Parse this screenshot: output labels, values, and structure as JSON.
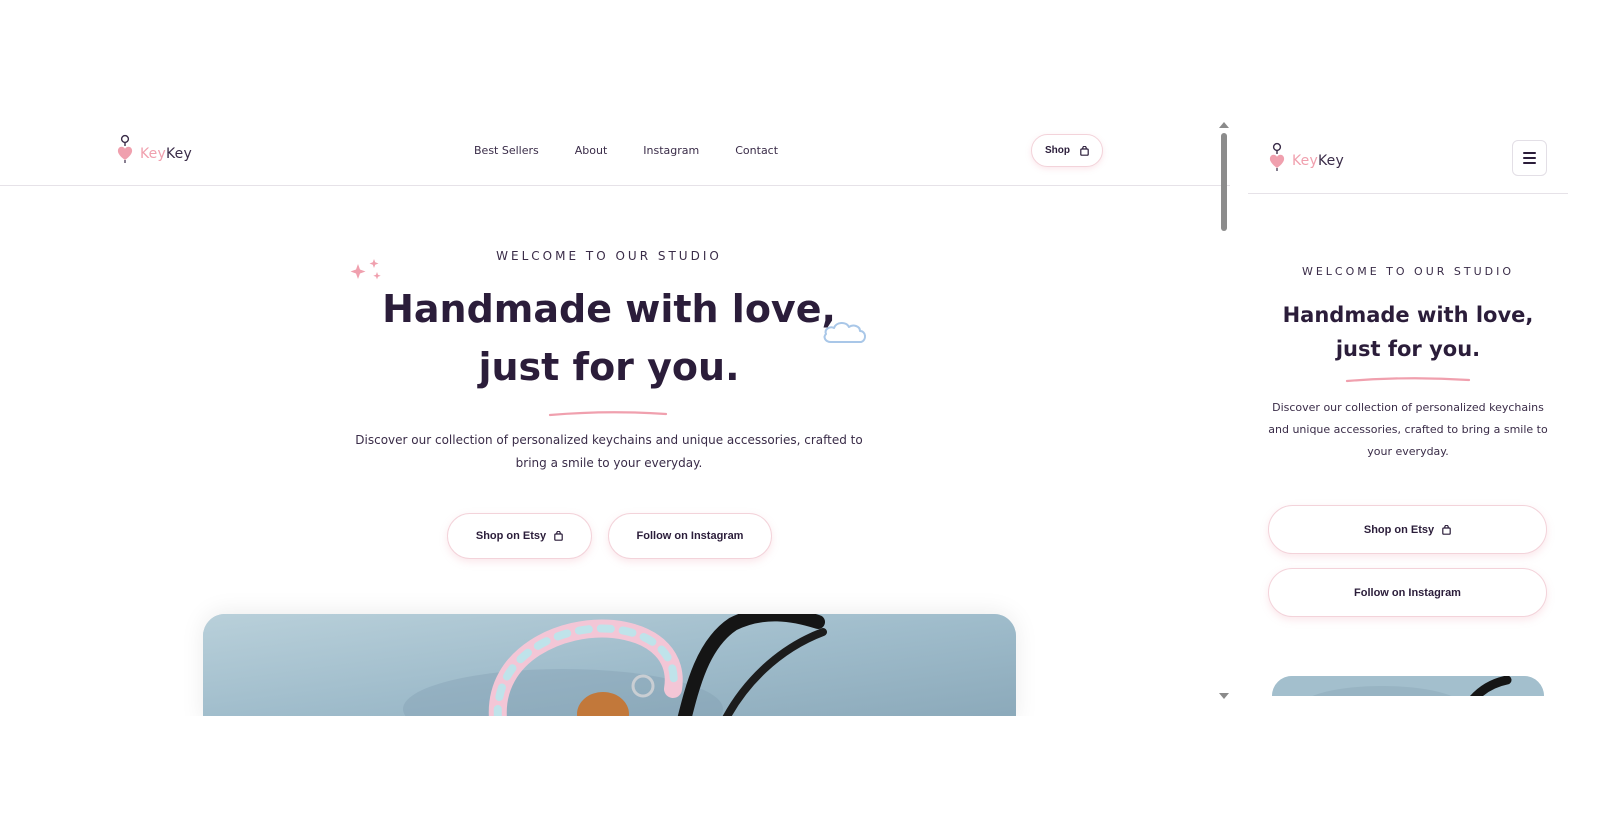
{
  "brand": {
    "part1": "Key",
    "part2": "Key"
  },
  "nav": {
    "links": [
      "Best Sellers",
      "About",
      "Instagram",
      "Contact"
    ],
    "shop_label": "Shop"
  },
  "hero": {
    "eyebrow": "WELCOME TO OUR STUDIO",
    "headline_line1": "Handmade with love,",
    "headline_line2": "just for you.",
    "description": "Discover our collection of personalized keychains and unique accessories, crafted to bring a smile to your everyday.",
    "cta_primary": "Shop on Etsy",
    "cta_secondary": "Follow on Instagram"
  },
  "colors": {
    "accent_pink": "#f0a0ae",
    "text_dark": "#2b1d3a",
    "cloud_blue": "#a9c7e8"
  },
  "icons": [
    "keychain-heart-logo-icon",
    "shopping-bag-icon",
    "sparkle-icon",
    "cloud-icon",
    "hamburger-menu-icon"
  ]
}
